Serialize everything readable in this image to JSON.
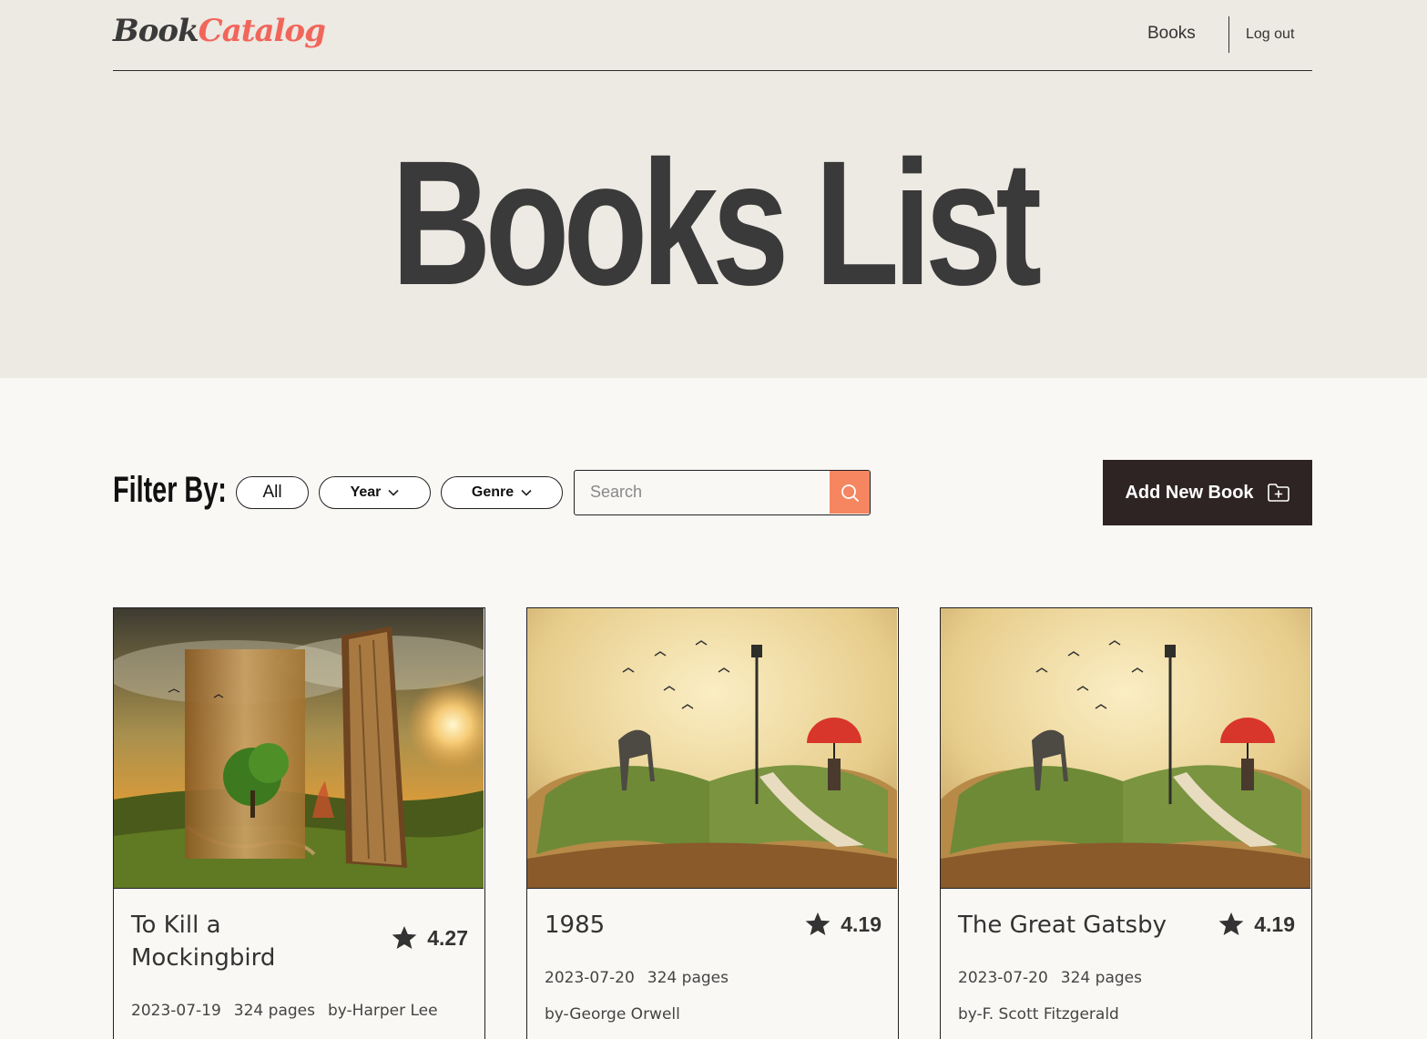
{
  "header": {
    "logo_part1": "Book",
    "logo_part2": "Catalog",
    "nav_books": "Books",
    "nav_logout": "Log out"
  },
  "hero": {
    "title": "Books List"
  },
  "filters": {
    "label": "Filter By:",
    "all": "All",
    "year": "Year",
    "genre": "Genre",
    "search_placeholder": "Search"
  },
  "actions": {
    "add_book": "Add New Book"
  },
  "books": [
    {
      "title": "To Kill a Mockingbird",
      "rating": "4.27",
      "date": "2023-07-19",
      "pages": "324 pages",
      "author": "by-Harper Lee"
    },
    {
      "title": "1985",
      "rating": "4.19",
      "date": "2023-07-20",
      "pages": "324 pages",
      "author": "by-George Orwell"
    },
    {
      "title": "The Great Gatsby",
      "rating": "4.19",
      "date": "2023-07-20",
      "pages": "324 pages",
      "author": "by-F. Scott Fitzgerald"
    }
  ],
  "colors": {
    "accent": "#f1665b",
    "search_button": "#f5865f",
    "dark_button": "#2e2424",
    "hero_bg": "#ede9e3"
  },
  "icons": {
    "rating": "star-icon",
    "search": "search-icon",
    "add": "folder-plus-icon",
    "dropdown": "chevron-down-icon"
  }
}
